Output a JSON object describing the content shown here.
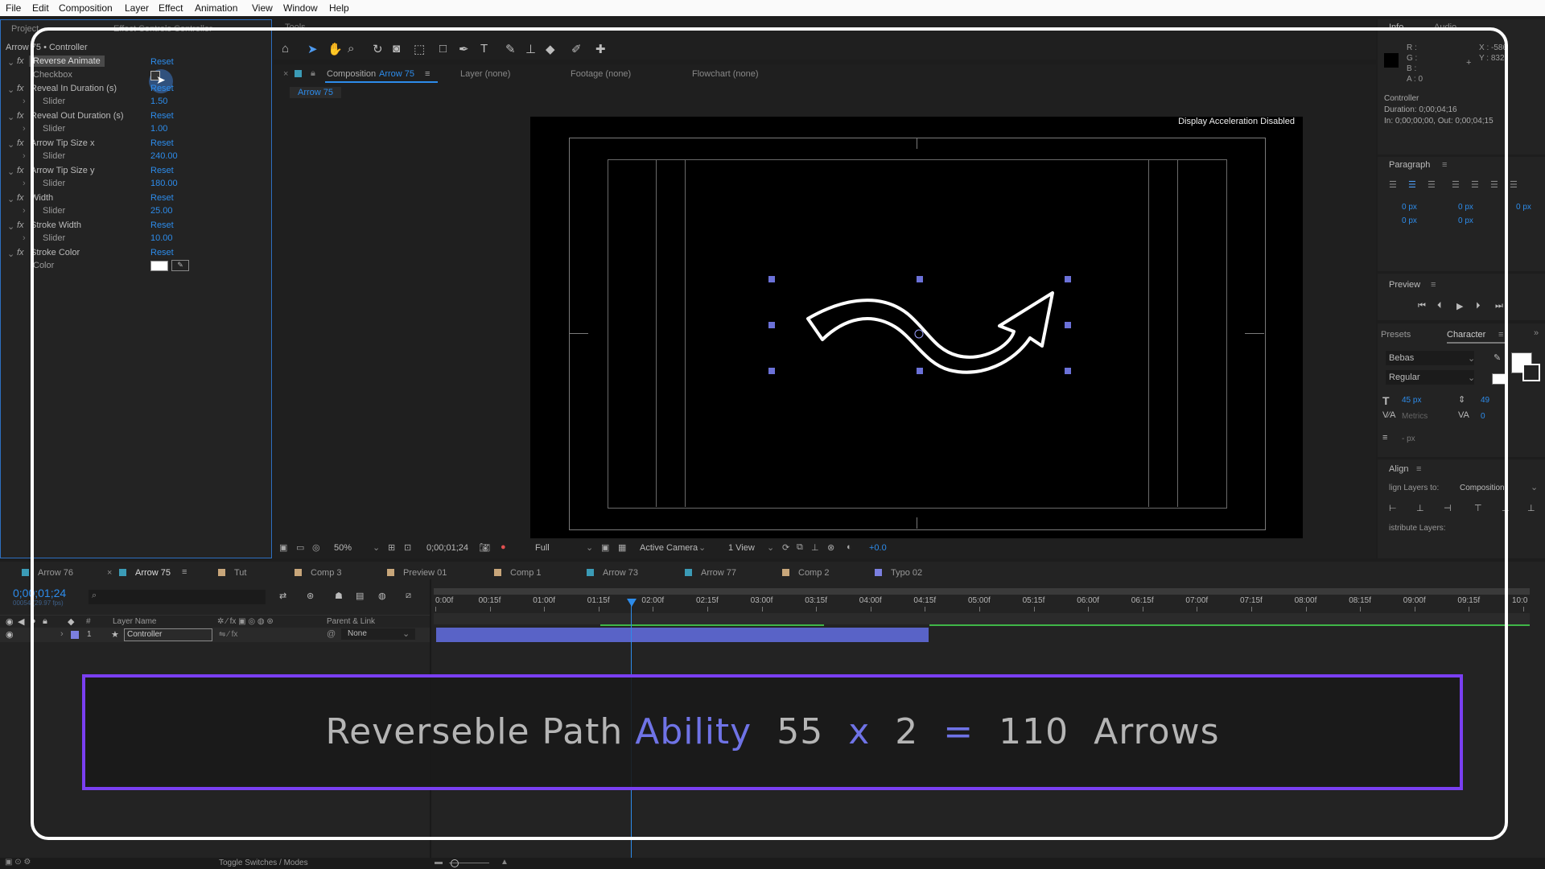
{
  "menu": [
    "File",
    "Edit",
    "Composition",
    "Layer",
    "Effect",
    "Animation",
    "View",
    "Window",
    "Help"
  ],
  "project_tabs": {
    "project": "Project",
    "effect_controls": "Effect Controls Controller",
    "tools": "Tools"
  },
  "effect_controls": {
    "header": "Arrow 75 • Controller",
    "effects": [
      {
        "name": "Reverse Animate",
        "reset": "Reset",
        "param": "Checkbox",
        "value": ""
      },
      {
        "name": "Reveal In Duration (s)",
        "reset": "Reset",
        "param": "Slider",
        "value": "1.50"
      },
      {
        "name": "Reveal Out Duration (s)",
        "reset": "Reset",
        "param": "Slider",
        "value": "1.00"
      },
      {
        "name": "Arrow Tip Size x",
        "reset": "Reset",
        "param": "Slider",
        "value": "240.00"
      },
      {
        "name": "Arrow Tip Size y",
        "reset": "Reset",
        "param": "Slider",
        "value": "180.00"
      },
      {
        "name": "Width",
        "reset": "Reset",
        "param": "Slider",
        "value": "25.00"
      },
      {
        "name": "Stroke Width",
        "reset": "Reset",
        "param": "Slider",
        "value": "10.00"
      },
      {
        "name": "Stroke Color",
        "reset": "Reset",
        "param": "Color",
        "value": ""
      }
    ]
  },
  "viewer": {
    "tabs": {
      "composition_prefix": "Composition",
      "composition_name": "Arrow 75",
      "layer": "Layer (none)",
      "footage": "Footage (none)",
      "flowchart": "Flowchart (none)"
    },
    "breadcrumb": "Arrow 75",
    "notice": "Display Acceleration Disabled",
    "footer": {
      "zoom": "50%",
      "timecode": "0;00;01;24",
      "resolution": "Full",
      "camera": "Active Camera",
      "views": "1 View",
      "exposure": "+0.0"
    }
  },
  "info": {
    "tabs": {
      "info": "Info",
      "audio": "Audio"
    },
    "rgba": [
      "R :",
      "G :",
      "B :",
      "A : 0"
    ],
    "xy": [
      "X : -586",
      "Y : 832"
    ],
    "layer": "Controller",
    "duration": "Duration: 0;00;04;16",
    "inout": "In: 0;00;00;00, Out: 0;00;04;15"
  },
  "paragraph": {
    "title": "Paragraph",
    "values": [
      "0 px",
      "0 px",
      "0 px",
      "0 px",
      "0 px"
    ]
  },
  "preview": {
    "title": "Preview"
  },
  "character": {
    "presets_tab": "Presets",
    "title": "Character",
    "font": "Bebas",
    "style": "Regular",
    "size": "45 px",
    "leading": "49",
    "kerning": "Metrics",
    "tracking": "0",
    "stroke": "- px"
  },
  "align": {
    "title": "Align",
    "align_to_label": "lign Layers to:",
    "align_to": "Composition",
    "distribute": "istribute Layers:"
  },
  "timeline": {
    "tabs": [
      "Arrow 76",
      "Arrow 75",
      "Tut",
      "Comp 3",
      "Preview 01",
      "Comp 1",
      "Arrow 73",
      "Arrow 77",
      "Comp 2",
      "Typo 02"
    ],
    "tab_colors": [
      "#3b9bb6",
      "#3b9bb6",
      "#c8a67a",
      "#c8a67a",
      "#c8a67a",
      "#c8a67a",
      "#3b9bb6",
      "#3b9bb6",
      "#c8a67a",
      "#7b7fe0"
    ],
    "timecode": "0;00;01;24",
    "fps": "00054 (29.97 fps)",
    "ruler": [
      "0:00f",
      "00:15f",
      "01:00f",
      "01:15f",
      "02:00f",
      "02:15f",
      "03:00f",
      "03:15f",
      "04:00f",
      "04:15f",
      "05:00f",
      "05:15f",
      "06:00f",
      "06:15f",
      "07:00f",
      "07:15f",
      "08:00f",
      "08:15f",
      "09:00f",
      "09:15f",
      "10:0"
    ],
    "columns": {
      "num": "#",
      "layer_name": "Layer Name",
      "parent": "Parent & Link"
    },
    "layer": {
      "num": "1",
      "name": "Controller",
      "parent": "None"
    },
    "toggle": "Toggle Switches / Modes"
  },
  "banner": {
    "part1": "Reverseble Path",
    "part2": "Ability",
    "part3": "55",
    "part4": "x",
    "part5": "2",
    "part6": "=",
    "part7": "110",
    "part8": "Arrows"
  }
}
